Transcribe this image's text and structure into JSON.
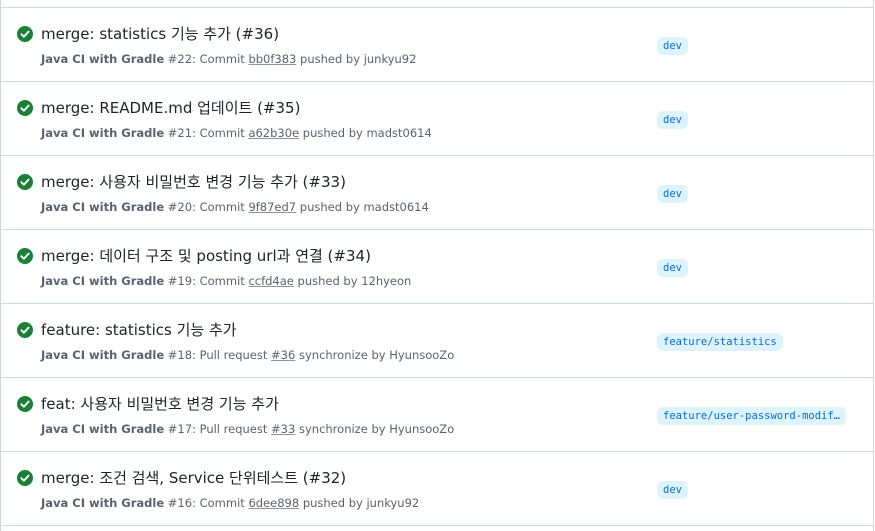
{
  "runs": [
    {
      "title": "merge: statistics 기능 추가 (#36)",
      "workflow": "Java CI with Gradle",
      "run_number": "#22",
      "trigger": "Commit",
      "ref": "bb0f383",
      "action": "pushed by",
      "actor": "junkyu92",
      "branch": "dev",
      "status": "success"
    },
    {
      "title": "merge: README.md 업데이트 (#35)",
      "workflow": "Java CI with Gradle",
      "run_number": "#21",
      "trigger": "Commit",
      "ref": "a62b30e",
      "action": "pushed by",
      "actor": "madst0614",
      "branch": "dev",
      "status": "success"
    },
    {
      "title": "merge: 사용자 비밀번호 변경 기능 추가 (#33)",
      "workflow": "Java CI with Gradle",
      "run_number": "#20",
      "trigger": "Commit",
      "ref": "9f87ed7",
      "action": "pushed by",
      "actor": "madst0614",
      "branch": "dev",
      "status": "success"
    },
    {
      "title": "merge: 데이터 구조 및 posting url과 연결 (#34)",
      "workflow": "Java CI with Gradle",
      "run_number": "#19",
      "trigger": "Commit",
      "ref": "ccfd4ae",
      "action": "pushed by",
      "actor": "12hyeon",
      "branch": "dev",
      "status": "success"
    },
    {
      "title": "feature: statistics 기능 추가",
      "workflow": "Java CI with Gradle",
      "run_number": "#18",
      "trigger": "Pull request",
      "ref": "#36",
      "action": "synchronize by",
      "actor": "HyunsooZo",
      "branch": "feature/statistics",
      "status": "success"
    },
    {
      "title": "feat: 사용자 비밀번호 변경 기능 추가",
      "workflow": "Java CI with Gradle",
      "run_number": "#17",
      "trigger": "Pull request",
      "ref": "#33",
      "action": "synchronize by",
      "actor": "HyunsooZo",
      "branch": "feature/user-password-modif…",
      "status": "success"
    },
    {
      "title": "merge: 조건 검색, Service 단위테스트 (#32)",
      "workflow": "Java CI with Gradle",
      "run_number": "#16",
      "trigger": "Commit",
      "ref": "6dee898",
      "action": "pushed by",
      "actor": "junkyu92",
      "branch": "dev",
      "status": "success"
    }
  ],
  "colors": {
    "success": "#1a7f37",
    "branch_bg": "#ddf4ff",
    "branch_fg": "#0969da",
    "border": "#d0d7de",
    "muted": "#59636e"
  },
  "icons": {
    "status": "check-circle-fill-icon"
  }
}
